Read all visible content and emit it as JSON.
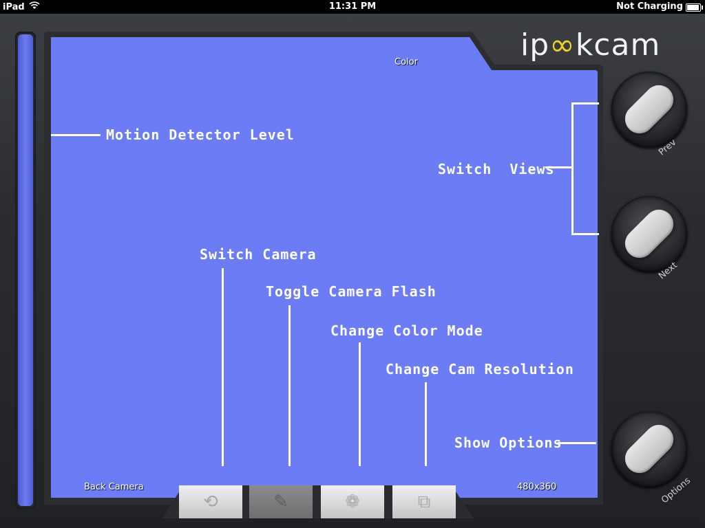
{
  "status_bar": {
    "device": "iPad",
    "time": "11:31 PM",
    "charging": "Not Charging",
    "wifi_icon": "wifi-icon",
    "battery_icon": "battery-icon"
  },
  "logo": {
    "part1": "ip",
    "part2": "∞",
    "part3": "kcam"
  },
  "screen": {
    "color_mode": "Color",
    "camera": "Back Camera",
    "resolution": "480x360",
    "background_color": "#6b7cf5"
  },
  "help_labels": {
    "motion_detector": "Motion Detector Level",
    "switch_views": "Switch  Views",
    "switch_camera": "Switch Camera",
    "toggle_flash": "Toggle Camera Flash",
    "change_color": "Change Color Mode",
    "change_resolution": "Change Cam Resolution",
    "show_options": "Show Options"
  },
  "side_buttons": {
    "prev": "Prev",
    "next": "Next",
    "options": "Options"
  },
  "toolbar": {
    "icons": [
      "switch-camera-icon",
      "flashlight-icon",
      "color-mode-icon",
      "resolution-icon"
    ]
  },
  "motion_level": 1.0,
  "accent": "#f1d21d"
}
